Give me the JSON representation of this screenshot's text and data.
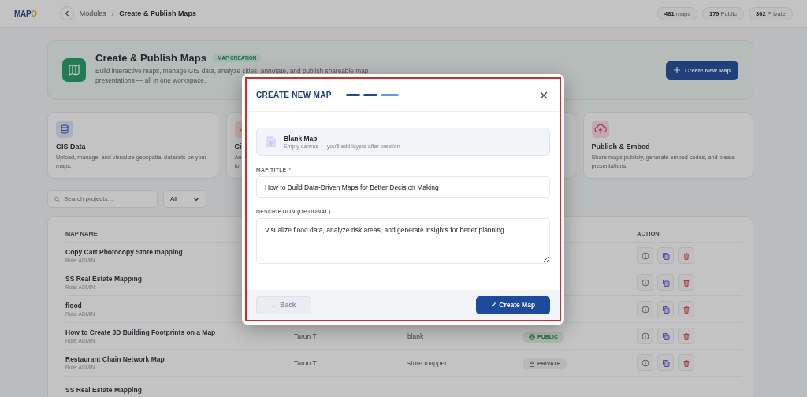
{
  "topbar": {
    "logo_main": "MAP",
    "logo_accent": "O",
    "breadcrumb": [
      "Modules",
      "Create & Publish Maps"
    ],
    "separator": "/",
    "stats": [
      "**481** maps",
      "**179** Public",
      "**302** Private"
    ]
  },
  "hero": {
    "title": "Create & Publish Maps",
    "badge": "MAP CREATION",
    "description": "Build interactive maps, manage GIS data, analyze cities, annotate, and publish shareable map presentations — all in one workspace.",
    "button": "Create New Map"
  },
  "features": [
    {
      "kind": "data",
      "title": "GIS Data",
      "description": "Upload, manage, and visualize geospatial datasets on your maps."
    },
    {
      "kind": "analysis",
      "title": "Ci",
      "description": "An for"
    },
    {
      "kind": "hidden"
    },
    {
      "kind": "publish",
      "title": "Publish & Embed",
      "description": "Share maps publicly, generate embed codes, and create presentations."
    }
  ],
  "filters": {
    "search_placeholder": "Search projects...",
    "select_value": "All"
  },
  "table": {
    "columns": {
      "column_1": "MAP NAME",
      "column_5": "ACTION"
    },
    "rows": [
      {
        "name": "Copy Cart Photocopy Store mapping",
        "role": "Role: ADMIN",
        "actions": true
      },
      {
        "name": "SS Real Estate Mapping",
        "role": "Role: ADMIN",
        "actions": true
      },
      {
        "name": "flood",
        "role": "Role: ADMIN",
        "actions": true
      },
      {
        "name": "How to Create 3D Building Footprints on a Map",
        "role": "Role: ADMIN",
        "owner": "Tarun T",
        "template": "blank",
        "visibility": {
          "kind": "public",
          "label": "PUBLIC"
        },
        "actions": true
      },
      {
        "name": "Restaurant Chain Network Map",
        "role": "Role: ADMIN",
        "owner": "Tarun T",
        "template": "store mapper",
        "visibility": {
          "kind": "private",
          "label": "PRIVATE"
        },
        "actions": true
      },
      {
        "name": "SS Real Estate Mapping",
        "actions": false
      }
    ]
  },
  "modal": {
    "title": "CREATE NEW MAP",
    "steps": [
      {
        "current": false
      },
      {
        "current": false
      },
      {
        "current": true
      }
    ],
    "template": {
      "name": "Blank Map",
      "description": "Empty canvas — you'll add layers after creation"
    },
    "title_label": "MAP TITLE",
    "required_mark": "*",
    "title_value": "How to Build Data-Driven Maps for Better Decision Making",
    "description_label": "DESCRIPTION (OPTIONAL)",
    "description_value": "Visualize flood data, analyze risk areas, and generate insights for better planning",
    "back_button": "← Back",
    "back_disabled": true,
    "submit_button": "✓ Create Map"
  }
}
